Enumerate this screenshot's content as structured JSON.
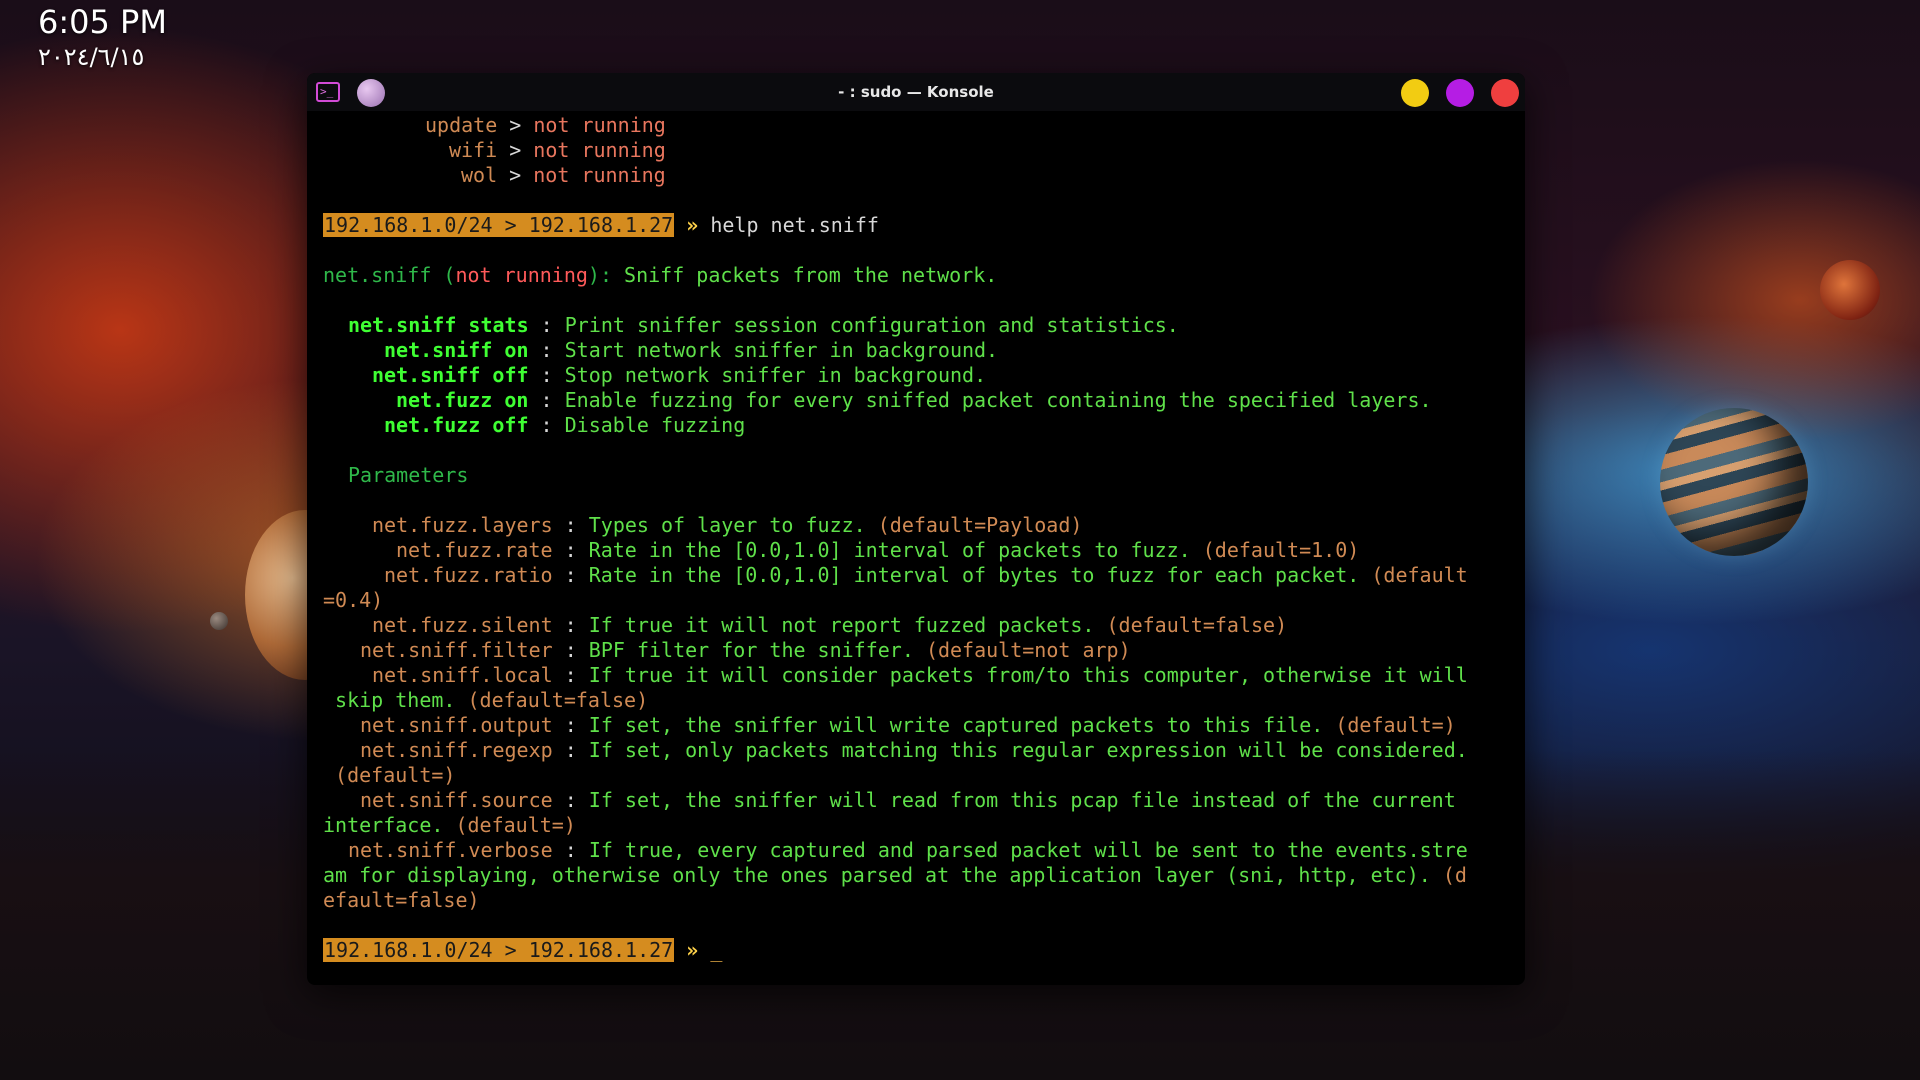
{
  "clock": {
    "time": "6:05 PM",
    "date": "٢٠٢٤/٦/١٥"
  },
  "window": {
    "title": "- : sudo — Konsole",
    "app_icon_glyph": ">_"
  },
  "colors": {
    "prompt_bg": "#d58c1f",
    "green": "#5fe04a",
    "orange": "#d08a54",
    "red": "#ff5a5a",
    "min_button": "#f2cc12",
    "max_button": "#b51de4",
    "close_button": "#ef3f3f"
  },
  "terminal": {
    "status_lines": [
      {
        "name": "update",
        "sep": " > ",
        "status": "not running"
      },
      {
        "name": "wifi",
        "sep": " > ",
        "status": "not running"
      },
      {
        "name": "wol",
        "sep": " > ",
        "status": "not running"
      }
    ],
    "prompt": {
      "subnet": "192.168.1.0/24 > 192.168.1.27",
      "arrow": "»",
      "command": "help net.sniff"
    },
    "module_header": {
      "name": "net.sniff",
      "open": " (",
      "state": "not running",
      "close": "): ",
      "desc": "Sniff packets from the network."
    },
    "commands": [
      {
        "name": "net.sniff stats",
        "sep": " : ",
        "desc": "Print sniffer session configuration and statistics."
      },
      {
        "name": "net.sniff on",
        "sep": " : ",
        "desc": "Start network sniffer in background."
      },
      {
        "name": "net.sniff off",
        "sep": " : ",
        "desc": "Stop network sniffer in background."
      },
      {
        "name": "net.fuzz on",
        "sep": " : ",
        "desc": "Enable fuzzing for every sniffed packet containing the specified layers."
      },
      {
        "name": "net.fuzz off",
        "sep": " : ",
        "desc": "Disable fuzzing"
      }
    ],
    "parameters_heading": "Parameters",
    "params": {
      "p1": {
        "name": "net.fuzz.layers",
        "sep": " : ",
        "desc": "Types of layer to fuzz. ",
        "def": "(default=Payload)"
      },
      "p2": {
        "name": "net.fuzz.rate",
        "sep": " : ",
        "desc": "Rate in the [0.0,1.0] interval of packets to fuzz. ",
        "def": "(default=1.0)"
      },
      "p3": {
        "name": "net.fuzz.ratio",
        "sep": " : ",
        "desc": "Rate in the [0.0,1.0] interval of bytes to fuzz for each packet. ",
        "def": "(default",
        "def_cont": "=0.4)"
      },
      "p4": {
        "name": "net.fuzz.silent",
        "sep": " : ",
        "desc": "If true it will not report fuzzed packets. ",
        "def": "(default=false)"
      },
      "p5": {
        "name": "net.sniff.filter",
        "sep": " : ",
        "desc": "BPF filter for the sniffer. ",
        "def": "(default=not arp)"
      },
      "p6": {
        "name": "net.sniff.local",
        "sep": " : ",
        "desc": "If true it will consider packets from/to this computer, otherwise it will",
        "desc_cont": " skip them. ",
        "def": "(default=false)"
      },
      "p7": {
        "name": "net.sniff.output",
        "sep": " : ",
        "desc": "If set, the sniffer will write captured packets to this file. ",
        "def": "(default=)"
      },
      "p8": {
        "name": "net.sniff.regexp",
        "sep": " : ",
        "desc": "If set, only packets matching this regular expression will be considered.",
        "def": " (default=)"
      },
      "p9": {
        "name": "net.sniff.source",
        "sep": " : ",
        "desc": "If set, the sniffer will read from this pcap file instead of the current",
        "desc_cont": "interface. ",
        "def": "(default=)"
      },
      "p10": {
        "name": "net.sniff.verbose",
        "sep": " : ",
        "desc": "If true, every captured and parsed packet will be sent to the events.stre",
        "desc_cont": "am for displaying, otherwise only the ones parsed at the application layer (sni, http, etc). ",
        "def": "(d",
        "def_cont": "efault=false)"
      }
    },
    "prompt2": {
      "subnet": "192.168.1.0/24 > 192.168.1.27",
      "arrow": "»",
      "cursor": "_"
    }
  }
}
